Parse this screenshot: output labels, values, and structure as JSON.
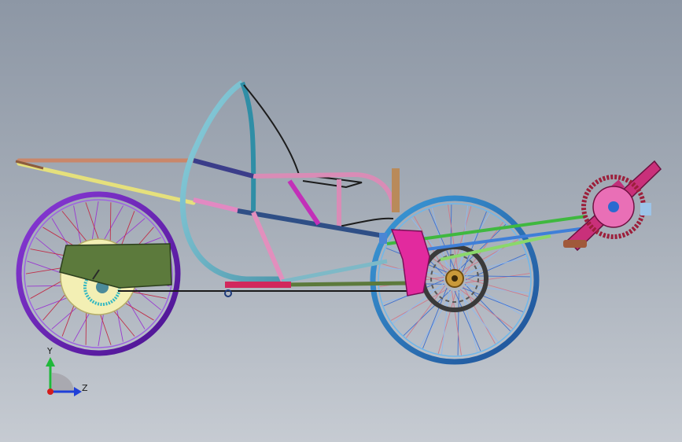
{
  "triad": {
    "y_label": "Y",
    "z_label": "Z",
    "colors": {
      "y": "#1fb83a",
      "z": "#1f3fd8",
      "x": "#d41c1c"
    }
  },
  "colors": {
    "background_top": "#8d97a5",
    "background_bottom": "#c6cbd2",
    "rear_rim": "#6a1cc0",
    "front_rim": "#2d7fc8",
    "seat_hoop": "#69b2c4",
    "boom": "#c0307a",
    "mudguard": "#5c7a3c"
  }
}
